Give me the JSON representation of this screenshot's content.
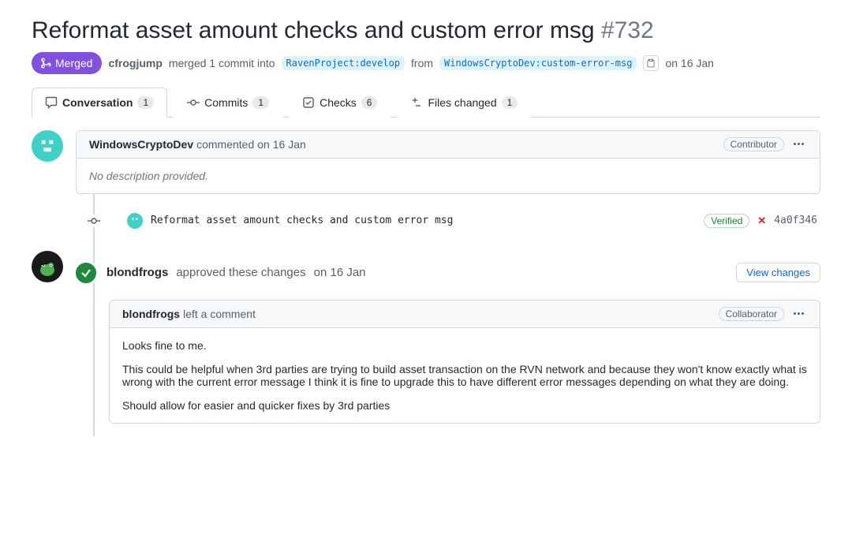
{
  "pr": {
    "title": "Reformat asset amount checks and custom error msg",
    "number": "#732",
    "state": "Merged",
    "merged_by": "cfrogjump",
    "merged_text_1": "merged 1 commit into",
    "base_branch": "RavenProject:develop",
    "merged_text_2": "from",
    "head_branch": "WindowsCryptoDev:custom-error-msg",
    "merged_date": "on 16 Jan"
  },
  "tabs": {
    "conversation": {
      "label": "Conversation",
      "count": "1"
    },
    "commits": {
      "label": "Commits",
      "count": "1"
    },
    "checks": {
      "label": "Checks",
      "count": "6"
    },
    "files": {
      "label": "Files changed",
      "count": "1"
    }
  },
  "first_comment": {
    "author": "WindowsCryptoDev",
    "action": "commented",
    "date": "on 16 Jan",
    "role": "Contributor",
    "body": "No description provided."
  },
  "commit": {
    "message": "Reformat asset amount checks and custom error msg",
    "verified": "Verified",
    "status_fail": "✕",
    "sha": "4a0f346"
  },
  "review": {
    "author": "blondfrogs",
    "action": "approved these changes",
    "date": "on 16 Jan",
    "view_changes": "View changes",
    "comment_author": "blondfrogs",
    "comment_action": "left a comment",
    "role": "Collaborator",
    "body_p1": "Looks fine to me.",
    "body_p2": "This could be helpful when 3rd parties are trying to build asset transaction on the RVN network and because they won't know exactly what is wrong with the current error message I think it is fine to upgrade this to have different error messages depending on what they are doing.",
    "body_p3": "Should allow for easier and quicker fixes by 3rd parties"
  }
}
